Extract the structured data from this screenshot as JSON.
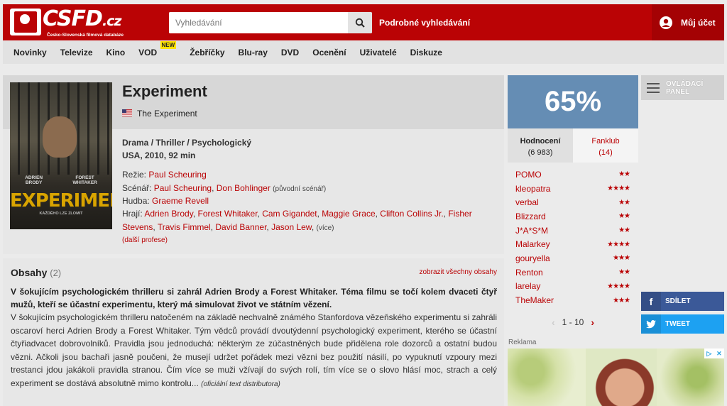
{
  "header": {
    "logo_text": "CSFD",
    "logo_tld": ".cz",
    "logo_subtitle": "Česko-Slovenská filmová databáze",
    "search_placeholder": "Vyhledávání",
    "advanced_search": "Podrobné vyhledávání",
    "account_label": "Můj účet"
  },
  "nav": {
    "items": [
      "Novinky",
      "Televize",
      "Kino",
      "VOD",
      "Žebříčky",
      "Blu-ray",
      "DVD",
      "Ocenění",
      "Uživatelé",
      "Diskuze"
    ],
    "new_badge": "NEW"
  },
  "film": {
    "title": "Experiment",
    "original_title": "The Experiment",
    "genres": "Drama / Thriller / Psychologický",
    "origin": "USA, 2010, 92 min",
    "poster": {
      "actor_left": "ADRIEN\nBRODY",
      "actor_right": "FOREST\nWHITAKER",
      "title": "EXPERIMENT",
      "tagline": "KAŽDÉHO LZE ZLOMIT"
    },
    "directing": {
      "label": "Režie:",
      "people": [
        "Paul Scheuring"
      ]
    },
    "screenplay": {
      "label": "Scénář:",
      "people": [
        "Paul Scheuring",
        "Don Bohlinger"
      ],
      "note": "(původní scénář)"
    },
    "music": {
      "label": "Hudba:",
      "people": [
        "Graeme Revell"
      ]
    },
    "cast": {
      "label": "Hrají:",
      "people": [
        "Adrien Brody",
        "Forest Whitaker",
        "Cam Gigandet",
        "Maggie Grace",
        "Clifton Collins Jr.",
        "Fisher Stevens",
        "Travis Fimmel",
        "David Banner",
        "Jason Lew"
      ],
      "more": "(více)"
    },
    "more_professions": "(další profese)"
  },
  "plot": {
    "title": "Obsahy",
    "count": "(2)",
    "show_all": "zobrazit všechny obsahy",
    "lead": "V šokujícím psychologickém thrilleru si zahrál Adrien Brody a Forest Whitaker. Téma filmu se točí kolem dvaceti čtyř mužů, kteří se účastní experimentu, který má simulovat život ve státním vězení.",
    "text": "V šokujícím psychologickém thrilleru natočeném na základě nechvalně známého Stanfordova vězeňského experimentu si zahráli oscaroví herci Adrien Brody a Forest Whitaker. Tým vědců provádí dvoutýdenní psychologický experiment, kterého se účastní čtyřiadvacet dobrovolníků. Pravidla jsou jednoduchá: některým ze zúčastněných bude přidělena role dozorců a ostatní budou vězni. Ačkoli jsou bachaři jasně poučeni, že musejí udržet pořádek mezi vězni bez použití násilí, po vypuknutí vzpoury mezi trestanci jdou jakákoli pravidla stranou. Čím více se muži vžívají do svých rolí, tím více se o slovo hlásí moc, strach a celý experiment se dostává absolutně mimo kontrolu...",
    "source": "(oficiální text distributora)"
  },
  "rating": {
    "percent": "65%",
    "tab_ratings_label": "Hodnocení",
    "tab_ratings_count": "(6 983)",
    "tab_fanclub_label": "Fanklub",
    "tab_fanclub_count": "(14)",
    "users": [
      {
        "name": "POMO",
        "stars": 2
      },
      {
        "name": "kleopatra",
        "stars": 4
      },
      {
        "name": "verbal",
        "stars": 2
      },
      {
        "name": "Blizzard",
        "stars": 2
      },
      {
        "name": "J*A*S*M",
        "stars": 2
      },
      {
        "name": "Malarkey",
        "stars": 4
      },
      {
        "name": "gouryella",
        "stars": 3
      },
      {
        "name": "Renton",
        "stars": 2
      },
      {
        "name": "larelay",
        "stars": 4
      },
      {
        "name": "TheMaker",
        "stars": 3
      }
    ],
    "pager": "1 - 10"
  },
  "side": {
    "control_panel": "OVLÁDACÍ PANEL",
    "share_facebook": "SDÍLET",
    "share_twitter": "TWEET"
  },
  "ad": {
    "label": "Reklama"
  },
  "colors": {
    "brand_red": "#ba0305",
    "rating_blue": "#658db4",
    "facebook": "#3b5998",
    "twitter": "#1da1f2",
    "new_badge": "#ffe200"
  },
  "icons": {
    "search": "search-icon",
    "account": "user-icon",
    "flag": "usa-flag-icon",
    "control_panel": "menu-icon",
    "facebook": "facebook-icon",
    "twitter": "twitter-icon"
  }
}
